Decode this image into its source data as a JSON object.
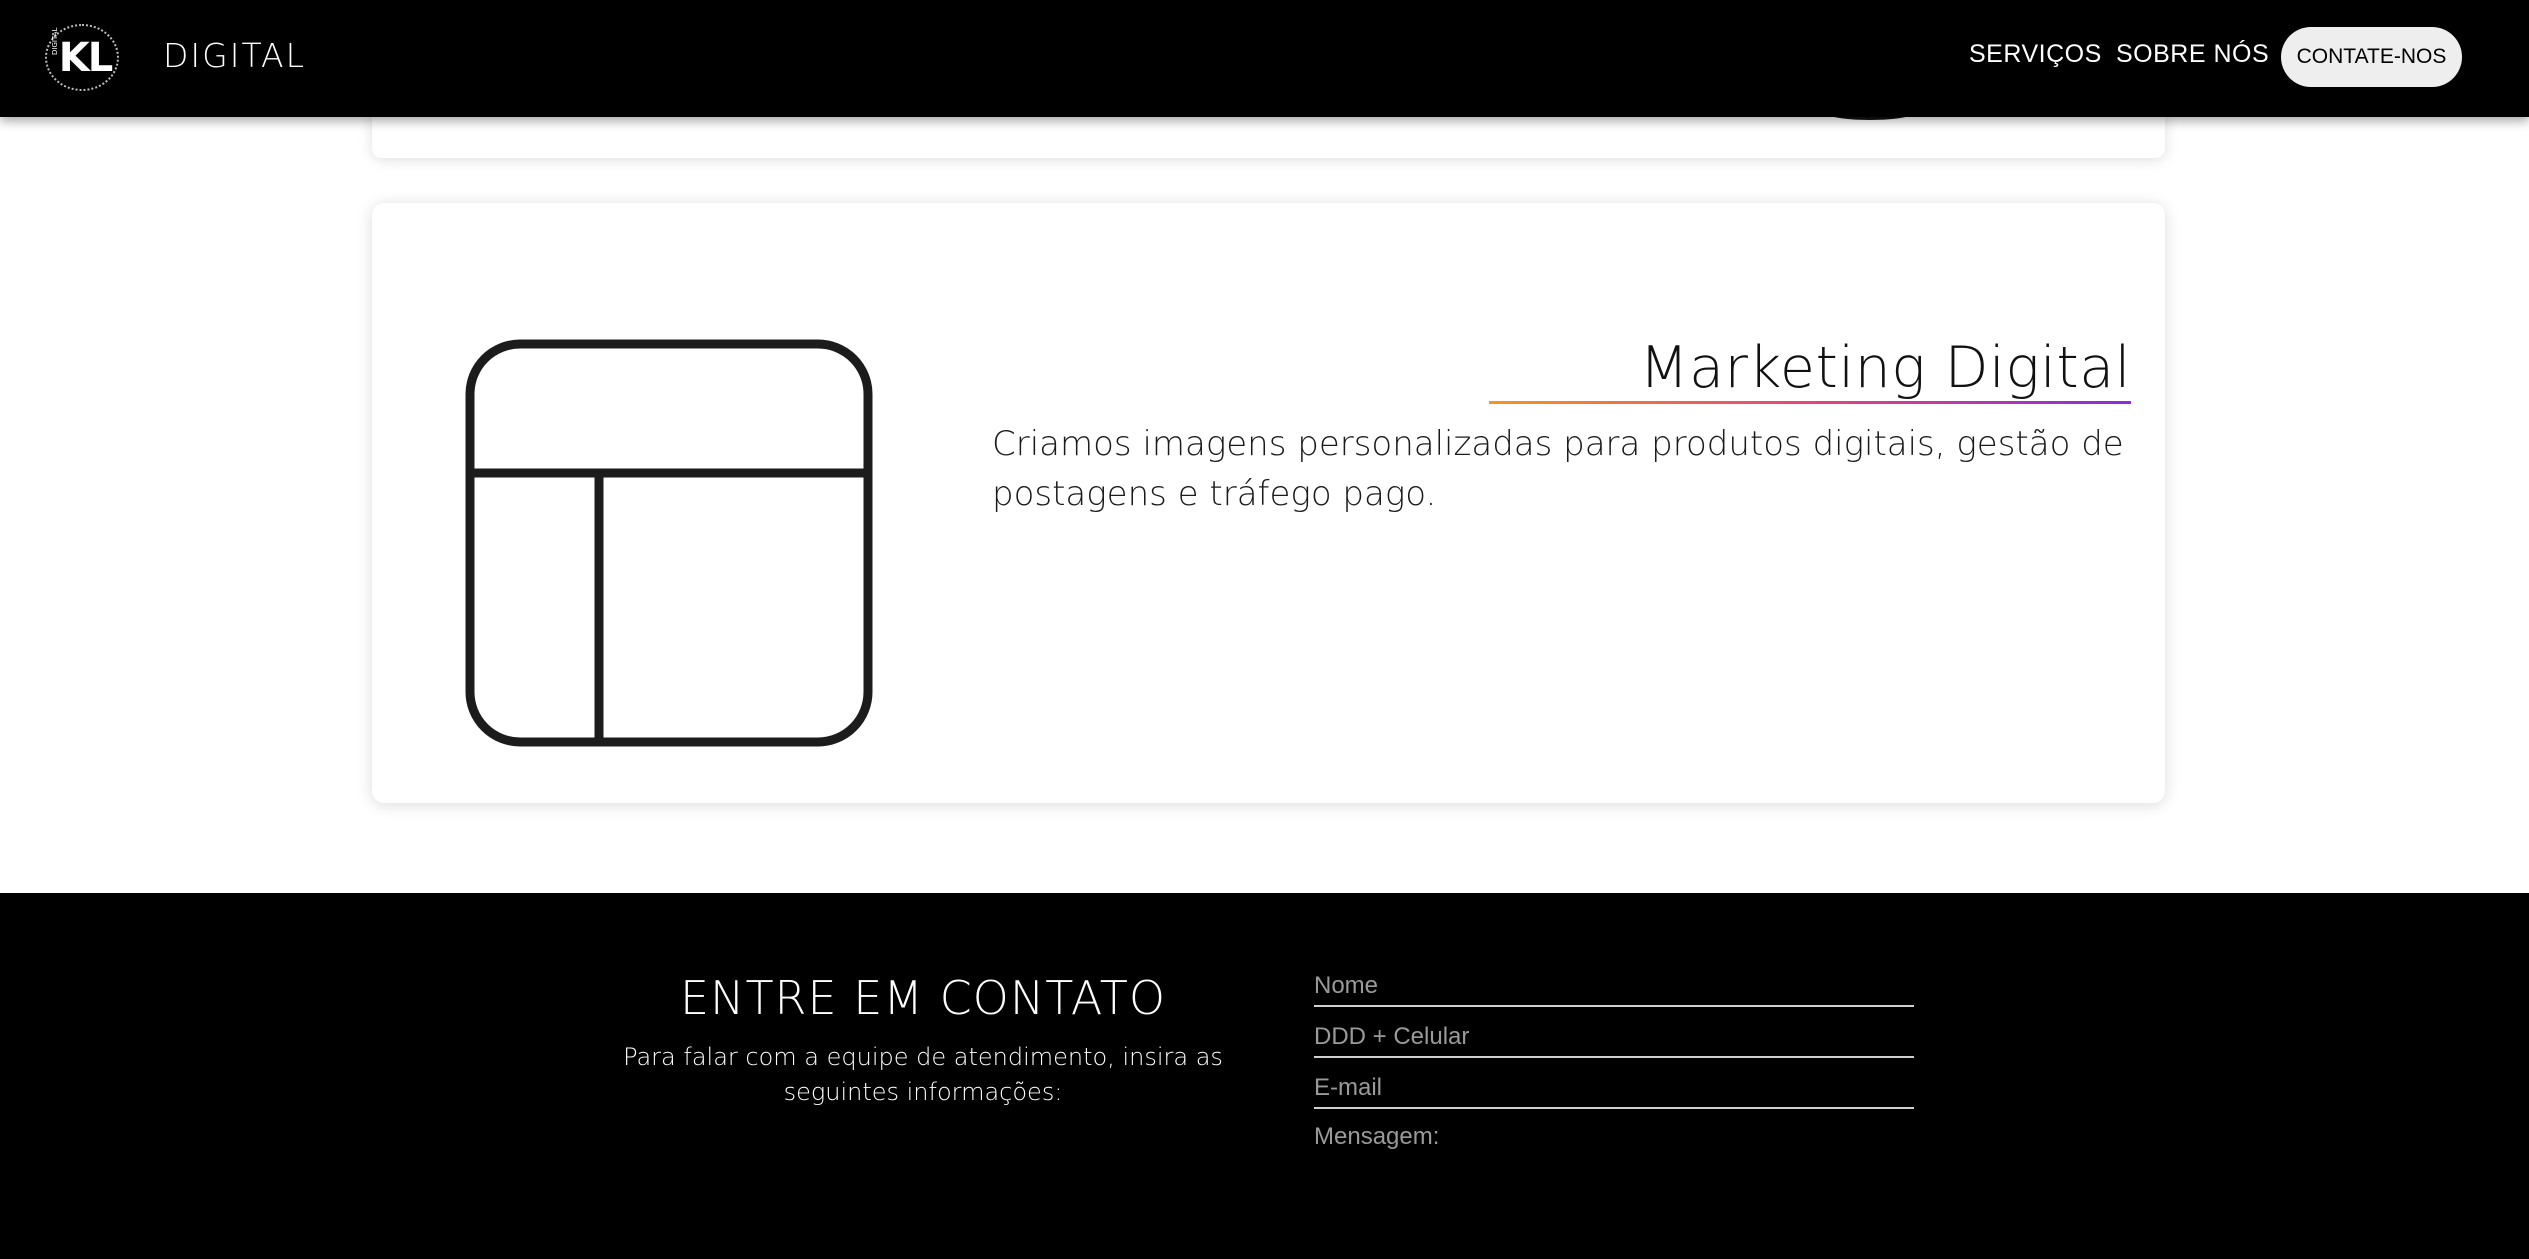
{
  "header": {
    "logo_mark": "KL",
    "logo_small": "DIGITAL",
    "brand_text": "DIGITAL",
    "nav": [
      "SERVIÇOS",
      "SOBRE NÓS"
    ],
    "cta_label": "CONTATE-NOS"
  },
  "service_card": {
    "title": "Marketing Digital",
    "description": "Criamos imagens personalizadas para produtos digitais, gestão de postagens e tráfego pago.",
    "icon": "layout-icon",
    "underline_colors": [
      "#f7941d",
      "#e9427a",
      "#8a2be2"
    ]
  },
  "footer": {
    "title": "ENTRE EM CONTATO",
    "subtitle": "Para falar com a equipe de atendimento, insira as seguintes informações:",
    "fields": {
      "name_placeholder": "Nome",
      "phone_placeholder": "DDD + Celular",
      "email_placeholder": "E-mail",
      "message_label": "Mensagem:"
    }
  }
}
